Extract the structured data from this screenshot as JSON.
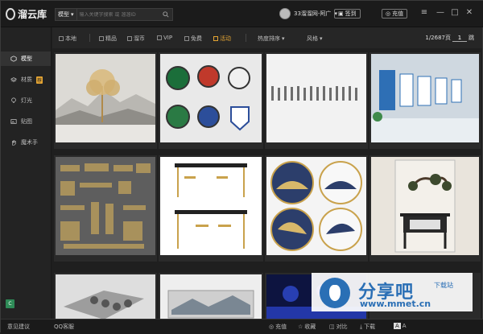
{
  "app": {
    "name": "溜云库"
  },
  "search": {
    "type_label": "模型",
    "placeholder": "输入关键字搜索 或 溜溜ID"
  },
  "user": {
    "name": "33溜溜网-阿广"
  },
  "header": {
    "signin_label": "签到",
    "recharge_label": "充值"
  },
  "window": {
    "menu": "≡",
    "minimize": "—",
    "maximize": "□",
    "close": "✕"
  },
  "filters": {
    "options": [
      {
        "label": "本地",
        "active": false
      },
      {
        "label": "精品",
        "active": false
      },
      {
        "label": "溜币",
        "active": false
      },
      {
        "label": "VIP",
        "active": false
      },
      {
        "label": "免费",
        "active": false
      },
      {
        "label": "活动",
        "active": true
      }
    ],
    "sort_label": "热度排序",
    "style_label": "风格"
  },
  "pager": {
    "current_page": "1",
    "total_label": "1/2687页",
    "go_label": "跳"
  },
  "sidebar": {
    "items": [
      {
        "label": "模型",
        "selected": true,
        "icon": "cube-icon"
      },
      {
        "label": "材质",
        "selected": false,
        "icon": "layers-icon",
        "badge": "荐"
      },
      {
        "label": "灯光",
        "selected": false,
        "icon": "bulb-icon"
      },
      {
        "label": "贴图",
        "selected": false,
        "icon": "image-icon"
      },
      {
        "label": "魔术手",
        "selected": false,
        "icon": "hand-icon"
      }
    ],
    "bottom_badge": "C"
  },
  "grid": {
    "items": [
      {
        "name": "landscape-tree-model"
      },
      {
        "name": "hanging-signs-model"
      },
      {
        "name": "people-figures-model"
      },
      {
        "name": "corporate-wall-model"
      },
      {
        "name": "carved-ornaments-model"
      },
      {
        "name": "bar-table-stools-model"
      },
      {
        "name": "round-art-panels-model"
      },
      {
        "name": "console-bonsai-model"
      },
      {
        "name": "wall-discs-model"
      },
      {
        "name": "framed-art-model"
      },
      {
        "name": "stage-scene-model"
      },
      {
        "name": "blank-model"
      }
    ]
  },
  "statusbar": {
    "feedback_label": "意见建议",
    "qq_label": "QQ客服",
    "recharge_label": "充值",
    "favorite_label": "收藏",
    "compare_label": "对比",
    "download_label": "下载"
  },
  "watermark": {
    "brand": "分享吧",
    "tag": "下载站",
    "url": "www.mmet.cn"
  }
}
